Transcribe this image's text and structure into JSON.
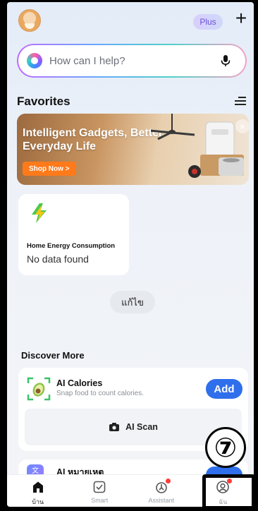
{
  "header": {
    "plan_badge": "Plus",
    "add_symbol": "+"
  },
  "search": {
    "placeholder": "How can I help?"
  },
  "favorites": {
    "title": "Favorites"
  },
  "banner": {
    "headline": "Intelligent Gadgets, Better Everyday Life",
    "cta": "Shop Now >",
    "close_symbol": "×"
  },
  "energy_card": {
    "title": "Home Energy Consumption",
    "status": "No data found"
  },
  "edit_label": "แก้ไข",
  "discover": {
    "title": "Discover More",
    "cards": [
      {
        "name": "AI Calories",
        "description": "Snap food to count calories.",
        "action": "Add",
        "scan_label": "AI Scan"
      },
      {
        "name": "AI หมายเหตุ"
      }
    ]
  },
  "bottom_nav": {
    "items": [
      {
        "label": "บ้าน",
        "icon": "home-icon",
        "active": true
      },
      {
        "label": "Smart",
        "icon": "smart-checkbox-icon",
        "active": false
      },
      {
        "label": "Assistant",
        "icon": "assistant-icon",
        "active": false,
        "badge": true
      },
      {
        "label": "ฉัน",
        "icon": "profile-icon",
        "active": false,
        "badge": true
      }
    ]
  },
  "annotation": {
    "step_number": "⑦"
  },
  "colors": {
    "accent_blue": "#2f6fec",
    "badge_red": "#ff3b3b",
    "shop_orange": "#ff7a1a"
  }
}
